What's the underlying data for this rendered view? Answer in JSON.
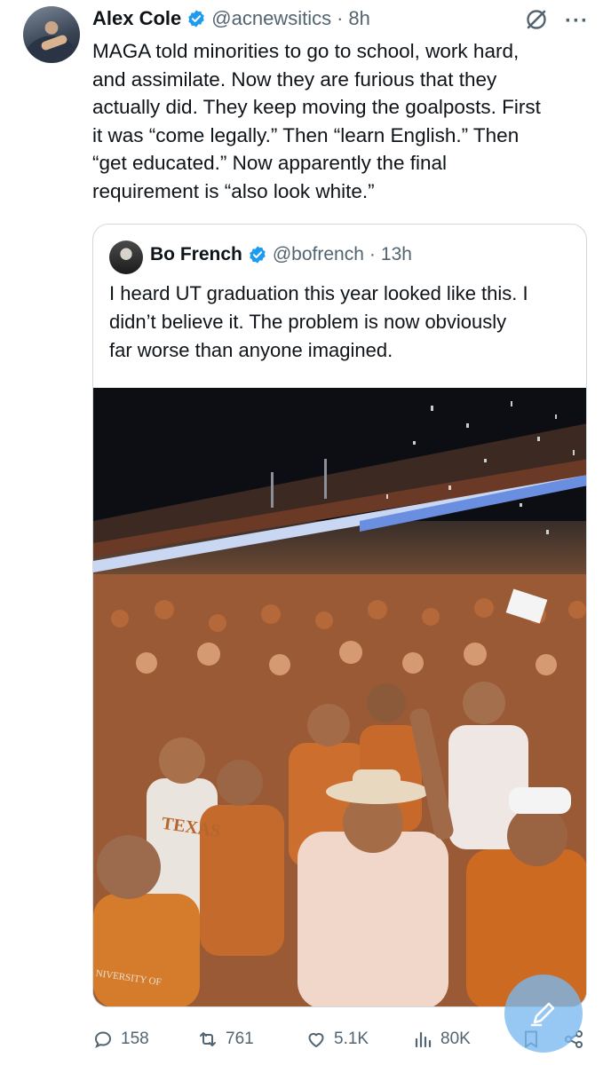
{
  "post": {
    "author_name": "Alex Cole",
    "author_handle": "@acnewsitics",
    "separator": "·",
    "time": "8h",
    "text_lines": [
      "MAGA told minorities to go to school, work hard,",
      "and assimilate. Now they are furious that they",
      "actually did. They keep moving the goalposts. First",
      "it was “come legally.” Then “learn English.” Then",
      "“get educated.” Now apparently the final",
      "requirement is “also look white.”"
    ]
  },
  "quoted": {
    "author_name": "Bo French",
    "author_handle": "@bofrench",
    "separator": "·",
    "time": "13h",
    "text_lines": [
      "I heard UT graduation this year looked like this. I",
      "didn’t believe it. The problem is now obviously",
      "far worse than anyone imagined."
    ],
    "image": {
      "jersey_text": "TEXAS",
      "sign_text": "NIVERSITY OF"
    }
  },
  "actions": {
    "replies": "158",
    "reposts": "761",
    "likes": "5.1K",
    "views": "80K"
  },
  "icons": {
    "verified": "verified-badge-icon",
    "grok": "grok-icon",
    "more": "more-icon",
    "reply": "reply-icon",
    "repost": "repost-icon",
    "like": "heart-icon",
    "views": "views-icon",
    "bookmark": "bookmark-icon",
    "share": "share-icon",
    "compose": "compose-icon"
  },
  "colors": {
    "verified": "#1d9bf0",
    "text": "#0f1419",
    "secondary": "#536471",
    "fab": "#78b8f0"
  }
}
